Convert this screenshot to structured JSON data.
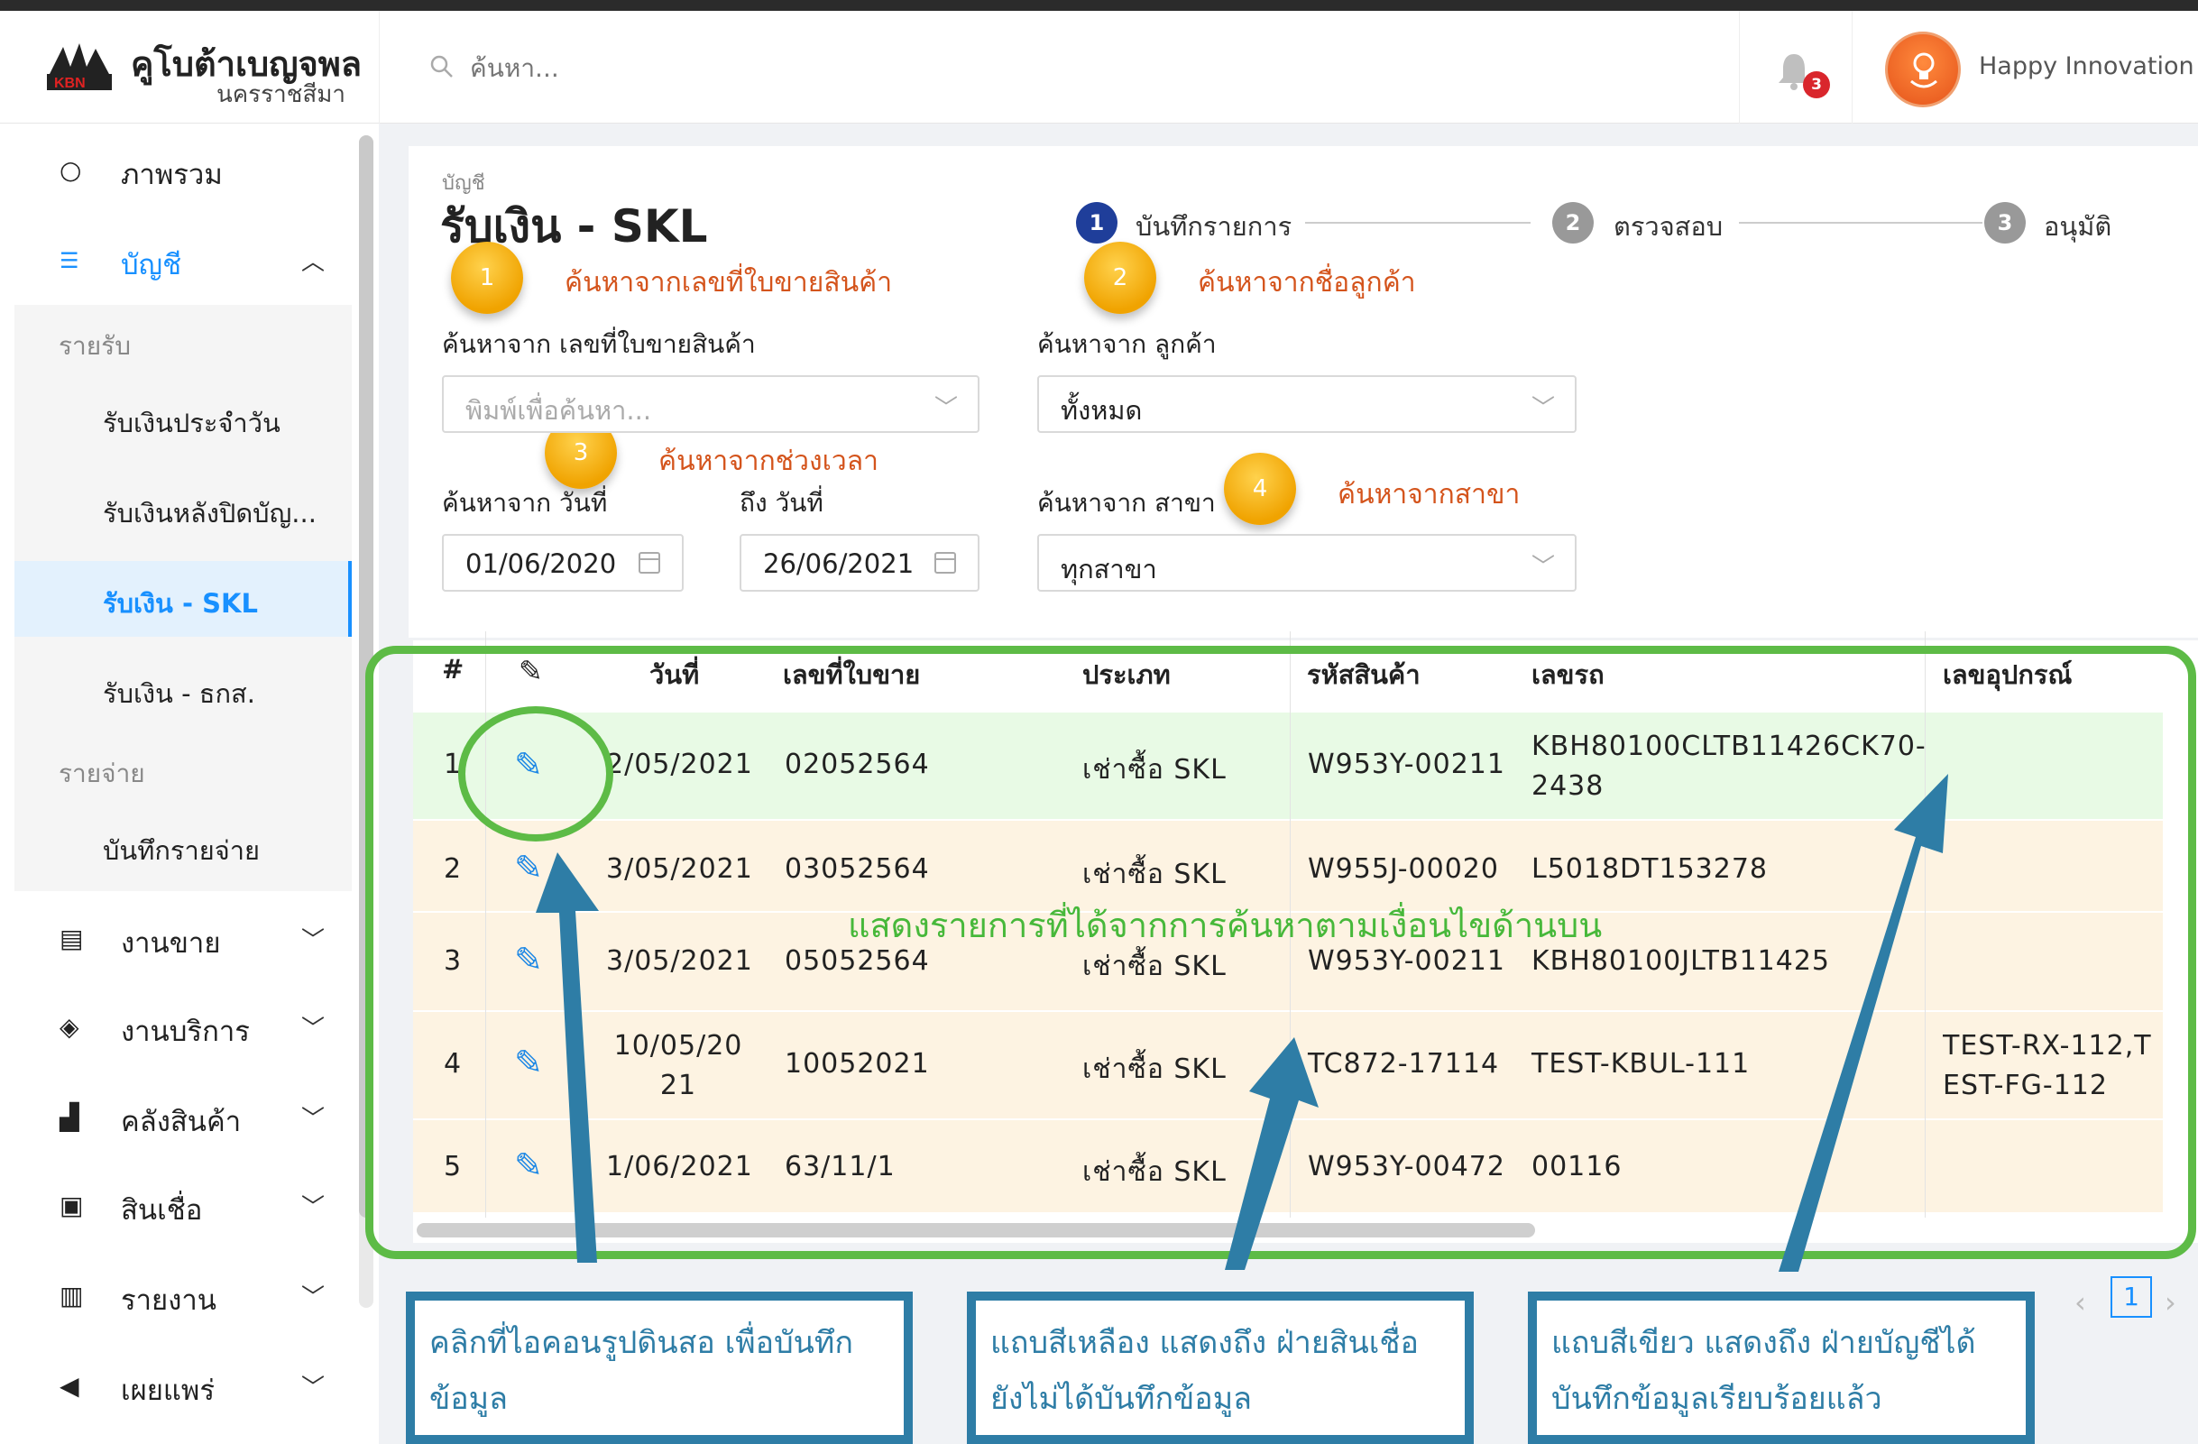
{
  "header": {
    "brand_title": "คูโบต้าเบญจพล",
    "brand_subtitle": "นครราชสีมา",
    "search_placeholder": "ค้นหา...",
    "notification_count": "3",
    "user_name": "Happy Innovation"
  },
  "sidebar": {
    "items": [
      {
        "label": "ภาพรวม",
        "icon": "circle-icon"
      },
      {
        "label": "บัญชี",
        "icon": "ledger-icon"
      },
      {
        "label": "งานขาย",
        "icon": "store-icon"
      },
      {
        "label": "งานบริการ",
        "icon": "tag-icon"
      },
      {
        "label": "คลังสินค้า",
        "icon": "warehouse-icon"
      },
      {
        "label": "สินเชื่อ",
        "icon": "briefcase-icon"
      },
      {
        "label": "รายงาน",
        "icon": "report-icon"
      },
      {
        "label": "เผยแพร่",
        "icon": "megaphone-icon"
      }
    ],
    "income_header": "รายรับ",
    "expense_header": "รายจ่าย",
    "sub_items": [
      "รับเงินประจำวัน",
      "รับเงินหลังปิดบัญ...",
      "รับเงิน - SKL",
      "รับเงิน - ธกส.",
      "บันทึกรายจ่าย"
    ]
  },
  "page": {
    "breadcrumb": "บัญชี",
    "title": "รับเงิน - SKL"
  },
  "steps": [
    {
      "num": "1",
      "label": "บันทึกรายการ"
    },
    {
      "num": "2",
      "label": "ตรวจสอบ"
    },
    {
      "num": "3",
      "label": "อนุมัติ"
    }
  ],
  "notes": [
    {
      "num": "1",
      "text": "ค้นหาจากเลขที่ใบขายสินค้า"
    },
    {
      "num": "2",
      "text": "ค้นหาจากชื่อลูกค้า"
    },
    {
      "num": "3",
      "text": "ค้นหาจากช่วงเวลา"
    },
    {
      "num": "4",
      "text": "ค้นหาจากสาขา"
    }
  ],
  "filters": {
    "invoice_label": "ค้นหาจาก เลขที่ใบขายสินค้า",
    "invoice_placeholder": "พิมพ์เพื่อค้นหา...",
    "customer_label": "ค้นหาจาก ลูกค้า",
    "customer_value": "ทั้งหมด",
    "date_from_label": "ค้นหาจาก วันที่",
    "date_from_value": "01/06/2020",
    "date_to_label": "ถึง วันที่",
    "date_to_value": "26/06/2021",
    "branch_label": "ค้นหาจาก สาขา",
    "branch_value": "ทุกสาขา"
  },
  "table": {
    "columns": [
      "#",
      "วันที่",
      "เลขที่ใบขาย",
      "ประเภท",
      "รหัสสินค้า",
      "เลขรถ",
      "เลขอุปกรณ์"
    ],
    "rows": [
      {
        "no": "1",
        "date": "2/05/2021",
        "invoice": "02052564",
        "type": "เช่าซื้อ SKL",
        "product": "W953Y-00211",
        "vehicle": "KBH80100CLTB11426CK70-2438",
        "device": ""
      },
      {
        "no": "2",
        "date": "3/05/2021",
        "invoice": "03052564",
        "type": "เช่าซื้อ SKL",
        "product": "W955J-00020",
        "vehicle": "L5018DT153278",
        "device": ""
      },
      {
        "no": "3",
        "date": "3/05/2021",
        "invoice": "05052564",
        "type": "เช่าซื้อ SKL",
        "product": "W953Y-00211",
        "vehicle": "KBH80100JLTB11425",
        "device": ""
      },
      {
        "no": "4",
        "date": "10/05/2021",
        "invoice": "10052021",
        "type": "เช่าซื้อ SKL",
        "product": "TC872-17114",
        "vehicle": "TEST-KBUL-111",
        "device": "TEST-RX-112,TEST-FG-112"
      },
      {
        "no": "5",
        "date": "1/06/2021",
        "invoice": "63/11/1",
        "type": "เช่าซื้อ SKL",
        "product": "W953Y-00472",
        "vehicle": "00116",
        "device": ""
      }
    ]
  },
  "annotations": {
    "green_text": "แสดงรายการที่ได้จากการค้นหาตามเงื่อนไขด้านบน",
    "callout_1": "คลิกที่ไอคอนรูปดินสอ เพื่อบันทึกข้อมูล",
    "callout_2": "แถบสีเหลือง แสดงถึง ฝ่ายสินเชื่อยังไม่ได้บันทึกข้อมูล",
    "callout_3": "แถบสีเขียว แสดงถึง ฝ่ายบัญชีได้บันทึกข้อมูลเรียบร้อยแล้ว"
  },
  "pager": {
    "current": "1"
  },
  "colors": {
    "accent": "#1890ff",
    "row_saved": "#e8fae5",
    "row_pending": "#fdf3e2",
    "annotation_green": "#5dbb46",
    "annotation_blue": "#2e7da6",
    "note_text": "#d4541c"
  }
}
